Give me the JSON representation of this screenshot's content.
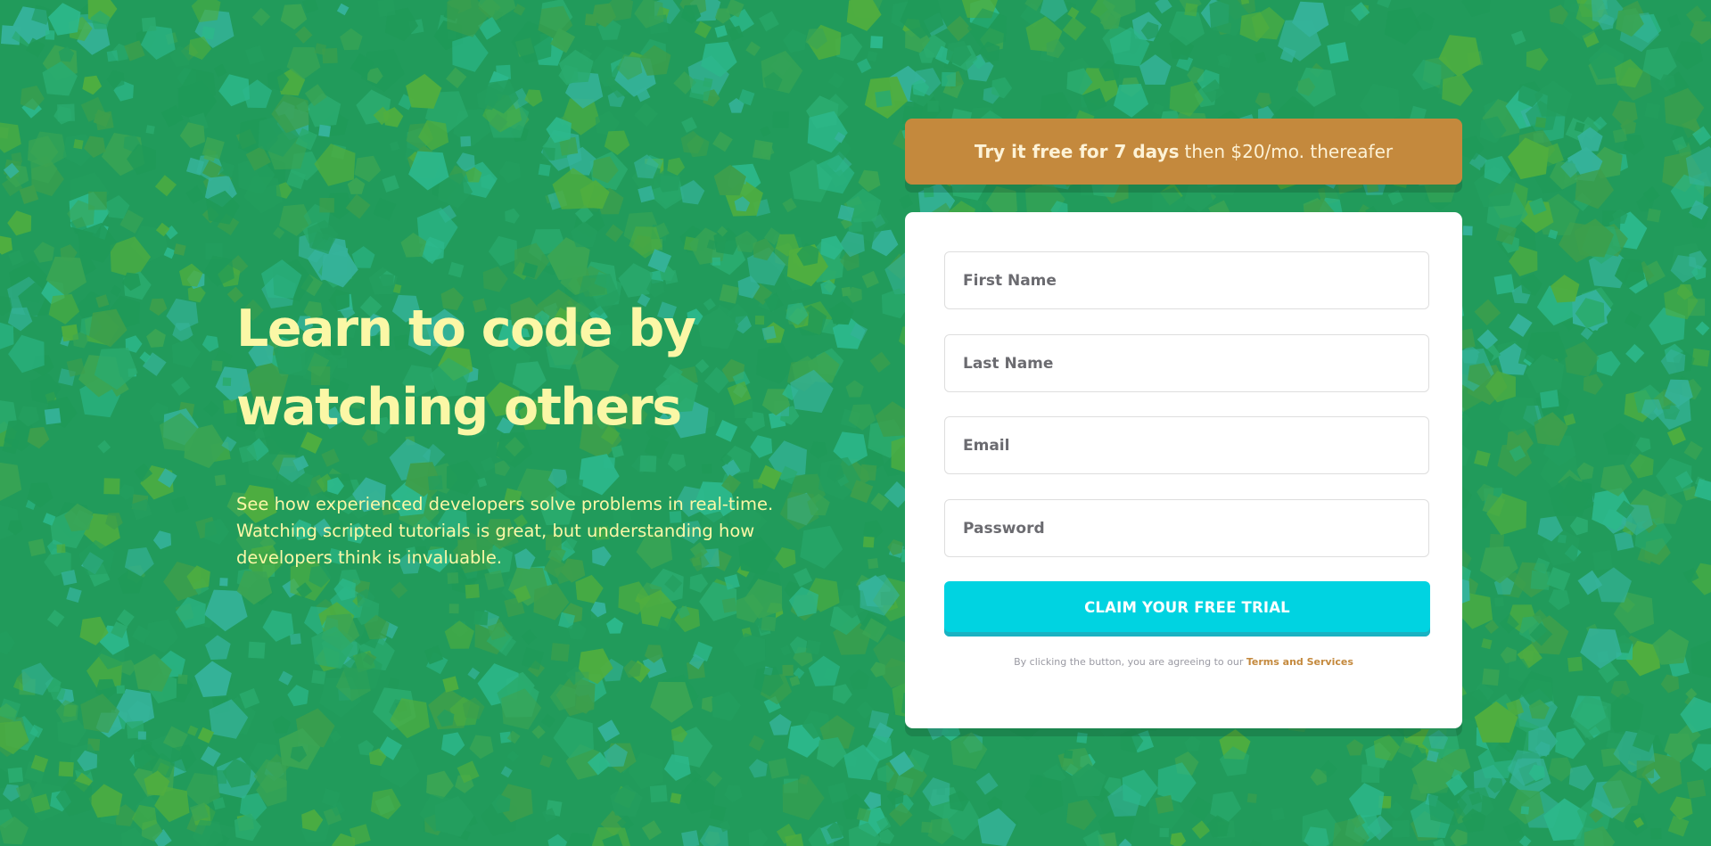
{
  "hero": {
    "title_line1": "Learn to code by",
    "title_line2": "watching others",
    "description": "See how experienced developers solve problems in real-time. Watching scripted tutorials is great, but understanding how developers think is invaluable."
  },
  "promo": {
    "bold_text": "Try it free for 7 days",
    "regular_text": "then $20/mo. thereafer"
  },
  "form": {
    "first_name_placeholder": "First Name",
    "last_name_placeholder": "Last Name",
    "email_placeholder": "Email",
    "password_placeholder": "Password",
    "submit_label": "CLAIM YOUR FREE TRIAL",
    "terms_text": "By clicking the button, you are agreeing to our",
    "terms_link": "Terms and Services"
  },
  "colors": {
    "background": "#219b5b",
    "heading": "#fbf7a6",
    "promo": "#c4893d",
    "button": "#00d3e1"
  }
}
